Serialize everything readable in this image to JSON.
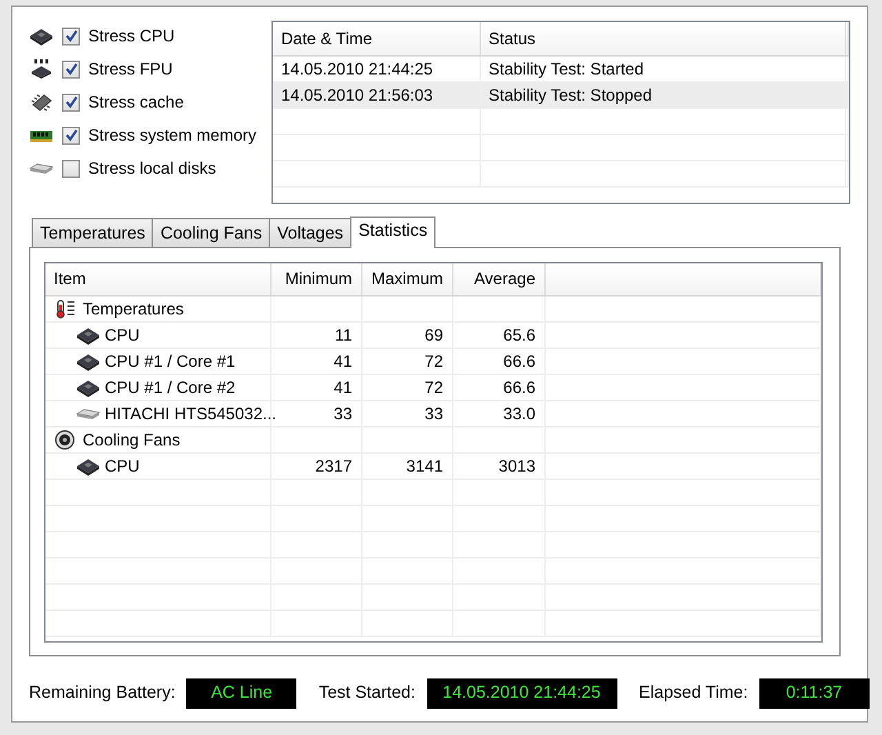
{
  "stress_options": [
    {
      "kind": "cpu",
      "label": "Stress CPU",
      "checked": true
    },
    {
      "kind": "fpu",
      "label": "Stress FPU",
      "checked": true
    },
    {
      "kind": "cache",
      "label": "Stress cache",
      "checked": true
    },
    {
      "kind": "memory",
      "label": "Stress system memory",
      "checked": true
    },
    {
      "kind": "disk",
      "label": "Stress local disks",
      "checked": false
    }
  ],
  "log": {
    "columns": [
      "Date & Time",
      "Status"
    ],
    "rows": [
      {
        "date_time": "14.05.2010 21:44:25",
        "status": "Stability Test: Started",
        "selected": false
      },
      {
        "date_time": "14.05.2010 21:56:03",
        "status": "Stability Test: Stopped",
        "selected": true
      }
    ]
  },
  "tabs": [
    {
      "label": "Temperatures",
      "selected": false
    },
    {
      "label": "Cooling Fans",
      "selected": false
    },
    {
      "label": "Voltages",
      "selected": false
    },
    {
      "label": "Statistics",
      "selected": true
    }
  ],
  "statistics": {
    "columns": [
      "Item",
      "Minimum",
      "Maximum",
      "Average"
    ],
    "rows": [
      {
        "kind": "temperature",
        "item": "Temperatures",
        "children": [
          {
            "kind": "cpu",
            "item": "CPU",
            "minimum": "11",
            "maximum": "69",
            "average": "65.6"
          },
          {
            "kind": "cpu",
            "item": "CPU #1 / Core #1",
            "minimum": "41",
            "maximum": "72",
            "average": "66.6"
          },
          {
            "kind": "cpu",
            "item": "CPU #1 / Core #2",
            "minimum": "41",
            "maximum": "72",
            "average": "66.6"
          },
          {
            "kind": "disk",
            "item": "HITACHI HTS545032...",
            "minimum": "33",
            "maximum": "33",
            "average": "33.0"
          }
        ]
      },
      {
        "kind": "fan",
        "item": "Cooling Fans",
        "children": [
          {
            "kind": "cpu",
            "item": "CPU",
            "minimum": "2317",
            "maximum": "3141",
            "average": "3013"
          }
        ]
      }
    ]
  },
  "status_bar": [
    {
      "label": "Remaining Battery:",
      "value": "AC Line"
    },
    {
      "label": "Test Started:",
      "value": "14.05.2010 21:44:25"
    },
    {
      "label": "Elapsed Time:",
      "value": "0:11:37"
    }
  ]
}
